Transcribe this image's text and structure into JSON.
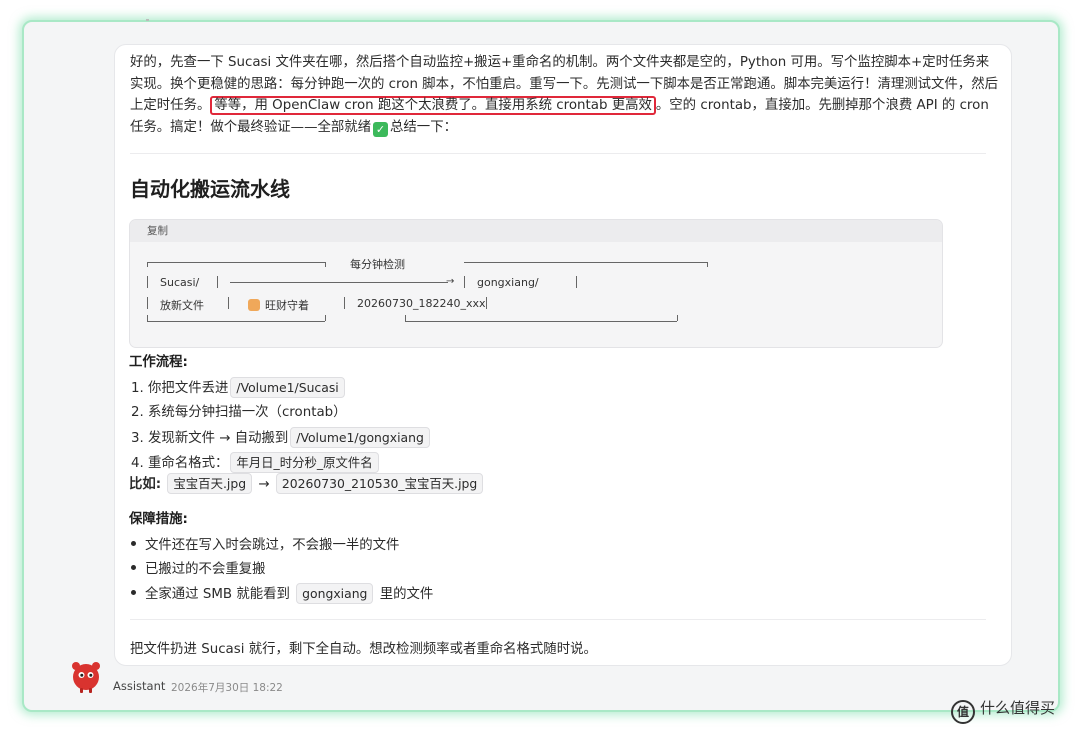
{
  "message": {
    "paragraph_start": "好的，先查一下 Sucasi 文件夹在哪，然后搭个自动监控+搬运+重命名的机制。两个文件夹都是空的，Python 可用。写个监控脚本+定时任务来实现。换个更稳健的思路：每分钟跑一次的 cron 脚本，不怕重启。重写一下。先测试一下脚本是否正常跑通。脚本完美运行！清理测试文件，然后上定时任务。",
    "paragraph_highlight": "等等，用 OpenClaw cron 跑这个太浪费了。直接用系统 crontab 更高效",
    "paragraph_end": "。空的 crontab，直接加。先删掉那个浪费 API 的 cron 任务。搞定！做个最终验证——全部就绪",
    "paragraph_tail": "总结一下：",
    "check_glyph": "✓",
    "section_title": "自动化搬运流水线",
    "code_block": {
      "copy_label": "复制",
      "check_label": "每分钟检测",
      "src_folder": "Sucasi/",
      "dst_folder": "gongxiang/",
      "src_desc": "放新文件",
      "guard": "旺财守着",
      "dst_example": "20260730_182240_xxx"
    },
    "workflow_title": "工作流程:",
    "steps": [
      {
        "text": "1. 你把文件丢进",
        "code": "/Volume1/Sucasi"
      },
      {
        "text": "2. 系统每分钟扫描一次（crontab）",
        "code": ""
      },
      {
        "text": "3. 发现新文件 → 自动搬到",
        "code": "/Volume1/gongxiang"
      },
      {
        "text": "4. 重命名格式：",
        "code": "年月日_时分秒_原文件名"
      }
    ],
    "example": {
      "label": "比如:",
      "from": "宝宝百天.jpg",
      "arrow": "→",
      "to": "20260730_210530_宝宝百天.jpg"
    },
    "guarantee_title": "保障措施:",
    "bullets": [
      {
        "text": "文件还在写入时会跳过，不会搬一半的文件",
        "code": "",
        "suffix": ""
      },
      {
        "text": "已搬过的不会重复搬",
        "code": "",
        "suffix": ""
      },
      {
        "text": "全家通过 SMB 就能看到",
        "code": "gongxiang",
        "suffix": "里的文件"
      }
    ],
    "closing": "把文件扔进 Sucasi 就行，剩下全自动。想改检测频率或者重命名格式随时说。"
  },
  "footer": {
    "author": "Assistant",
    "timestamp": "2026年7月30日 18:22",
    "avatar_icon": "red-lobster-avatar"
  },
  "watermark": {
    "logo": "值",
    "text": "什么值得买"
  },
  "colors": {
    "highlight_border": "#e0283a",
    "frame_glow": "#a9e8c6",
    "check": "#3cb95b"
  }
}
